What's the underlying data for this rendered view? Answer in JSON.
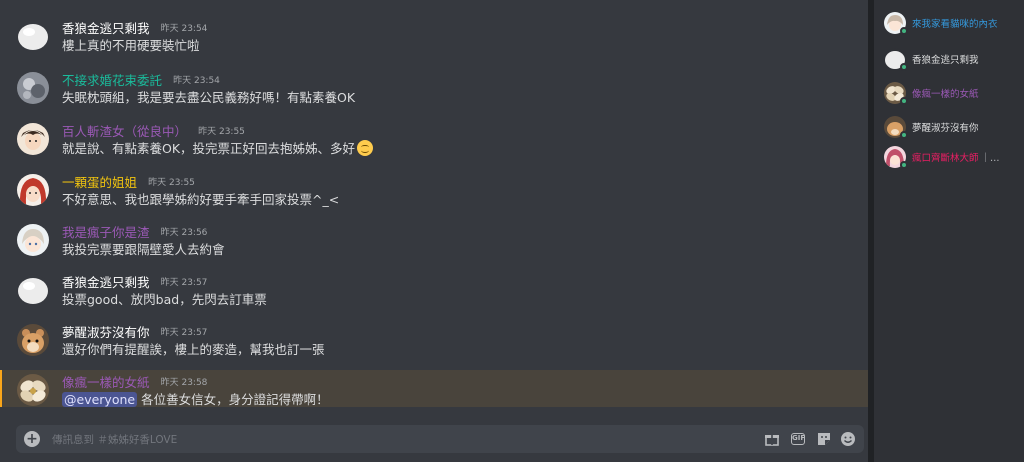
{
  "messages": [
    {
      "author": "香狼金逃只剩我",
      "name_color": "#ffffff",
      "timestamp": "昨天 23:54",
      "text": "樓上真的不用硬要裝忙啦",
      "avatar": "white-blob"
    },
    {
      "author": "不接求婚花束委託",
      "name_color": "#1abc9c",
      "timestamp": "昨天 23:54",
      "text": "失眠枕頭組，我是要去盡公民義務好嗎！有點素養OK",
      "avatar": "grey-photo"
    },
    {
      "author": "百人斬渣女（從良中）",
      "name_color": "#9b59b6",
      "timestamp": "昨天 23:55",
      "text": "就是說、有點素養OK，投完票正好回去抱姊姊、多好",
      "emoji": "smile-emoji",
      "avatar": "anime-boy"
    },
    {
      "author": "一顆蛋的姐姐",
      "name_color": "#f1c40f",
      "timestamp": "昨天 23:55",
      "text": "不好意思、我也跟學姊約好要手牽手回家投票^_<",
      "avatar": "red-hair"
    },
    {
      "author": "我是瘋子你是渣",
      "name_color": "#9b59b6",
      "timestamp": "昨天 23:56",
      "text": "我投完票要跟隔壁愛人去約會",
      "avatar": "anime-girl"
    },
    {
      "author": "香狼金逃只剩我",
      "name_color": "#ffffff",
      "timestamp": "昨天 23:57",
      "text": "投票good、放閃bad，先閃去訂車票",
      "avatar": "white-blob"
    },
    {
      "author": "夢醒淑芬沒有你",
      "name_color": "#ffffff",
      "timestamp": "昨天 23:57",
      "text": "還好你們有提醒誒，樓上的麥造，幫我也訂一張",
      "avatar": "hamster"
    },
    {
      "author": "像瘋一樣的女紙",
      "name_color": "#9b59b6",
      "timestamp": "昨天 23:58",
      "mention": "@everyone",
      "text": "各位善女信女，身分證記得帶啊！",
      "avatar": "flower",
      "highlighted": true
    }
  ],
  "composer": {
    "placeholder": "傳訊息到 ＃姊姊好香LOVE",
    "tools": [
      "gift-icon",
      "gif-icon",
      "sticker-icon",
      "emoji-icon"
    ],
    "gif_label": "GIF"
  },
  "members": [
    {
      "name": "來我家看貓咪的內衣",
      "color": "#3498db",
      "avatar": "anime-girl"
    },
    {
      "name": "香狼金逃只剩我",
      "color": "#dcddde",
      "avatar": "white-blob"
    },
    {
      "name": "像瘋一樣的女紙",
      "color": "#9b59b6",
      "avatar": "flower"
    },
    {
      "name": "夢醒淑芬沒有你",
      "color": "#dcddde",
      "avatar": "hamster"
    },
    {
      "name": "瘋口齊斷林大師",
      "color": "#e91e63",
      "avatar": "pink-girl",
      "extra": "｜…"
    }
  ]
}
